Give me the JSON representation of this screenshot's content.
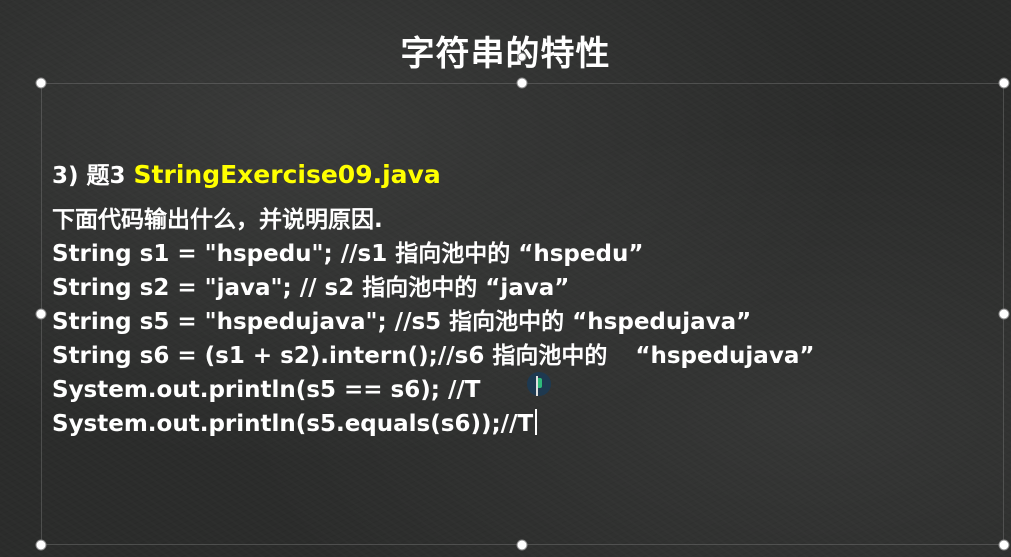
{
  "slide": {
    "title": "字符串的特性",
    "heading_prefix": "3) 题3 ",
    "heading_file": "StringExercise09.java",
    "question": "下面代码输出什么，并说明原因.",
    "lines": [
      "String s1 = \"hspedu\";  //s1 指向池中的 “hspedu”",
      "String s2 = \"java\"; // s2 指向池中的 “java”",
      "String s5 = \"hspedujava\"; //s5 指向池中的 “hspedujava”",
      "String s6 = (s1 + s2).intern();//s6 指向池中的",
      "“hspedujava”",
      "System.out.println(s5 == s6); //T",
      "System.out.println(s5.equals(s6));//T"
    ]
  },
  "colors": {
    "background": "#2b2c2b",
    "text": "#ffffff",
    "highlight": "#ffff00"
  }
}
